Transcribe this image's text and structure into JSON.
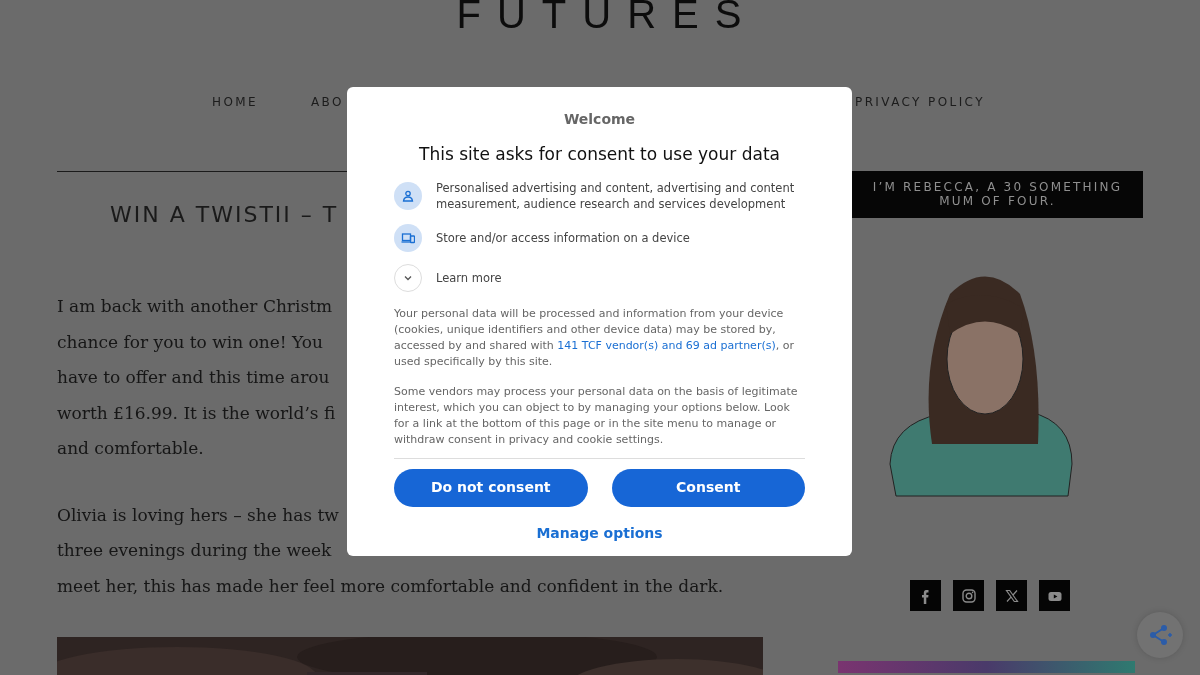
{
  "site": {
    "logo": "FUTURES",
    "nav": [
      "HOME",
      "ABO",
      "PRIVACY POLICY"
    ]
  },
  "article": {
    "title": "WIN A TWISTII – T",
    "paragraphs": [
      [
        "I am back with another Christm",
        "chance for you to win one! You",
        "have to offer and this time arou",
        "worth £16.99. It is the world’s fi",
        "and comfortable."
      ],
      [
        "Olivia is loving hers – she has tw",
        "three evenings during the week",
        "meet her, this has made her feel more comfortable and confident in the dark."
      ]
    ]
  },
  "sidebar": {
    "intro": "I’M REBECCA, A 30 SOMETHING MUM OF FOUR."
  },
  "consent": {
    "welcome": "Welcome",
    "title": "This site asks for consent to use your data",
    "purposes": [
      {
        "kind": "person",
        "text": "Personalised advertising and content, advertising and content measurement, audience research and services development"
      },
      {
        "kind": "device",
        "text": "Store and/or access information on a device"
      }
    ],
    "learn_more": {
      "label": "Learn more",
      "expanded": false
    },
    "notice": {
      "before": "Your personal data will be processed and information from your device (cookies, unique identifiers and other device data) may be stored by, accessed by and shared with ",
      "link": "141 TCF vendor(s) and 69 ad partner(s)",
      "after": ", or used specifically by this site."
    },
    "legitimate_interest": "Some vendors may process your personal data on the basis of legitimate interest, which you can object to by managing your options below. Look for a link at the bottom of this page or in the site menu to manage or withdraw consent in privacy and cookie settings.",
    "buttons": [
      "Do not consent",
      "Consent"
    ],
    "manage": "Manage options"
  }
}
